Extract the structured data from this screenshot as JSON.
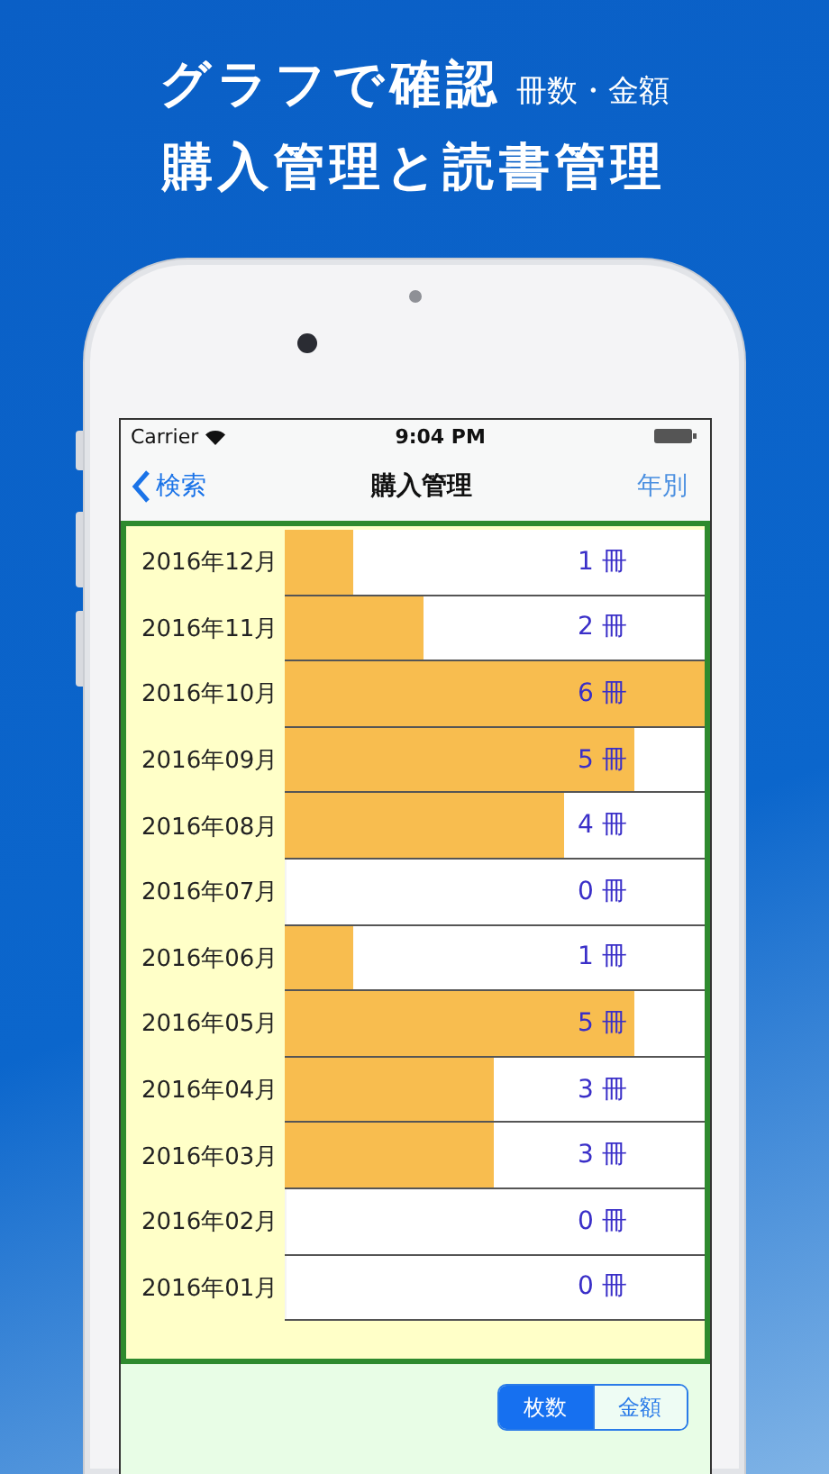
{
  "headline": {
    "title": "グラフで確認",
    "subtitle": "冊数・金額",
    "line2": "購入管理と読書管理"
  },
  "status_bar": {
    "carrier": "Carrier",
    "time": "9:04 PM"
  },
  "nav_bar": {
    "back": "検索",
    "title": "購入管理",
    "right": "年別"
  },
  "rows": [
    {
      "month": "2016年12月",
      "count": "1 冊",
      "level": 0.167
    },
    {
      "month": "2016年11月",
      "count": "2 冊",
      "level": 0.333
    },
    {
      "month": "2016年10月",
      "count": "6 冊",
      "level": 1
    },
    {
      "month": "2016年09月",
      "count": "5 冊",
      "level": 0.833
    },
    {
      "month": "2016年08月",
      "count": "4 冊",
      "level": 0.667
    },
    {
      "month": "2016年07月",
      "count": "0 冊",
      "level": 0
    },
    {
      "month": "2016年06月",
      "count": "1 冊",
      "level": 0.167
    },
    {
      "month": "2016年05月",
      "count": "5 冊",
      "level": 0.833
    },
    {
      "month": "2016年04月",
      "count": "3 冊",
      "level": 0.5
    },
    {
      "month": "2016年03月",
      "count": "3 冊",
      "level": 0.5
    },
    {
      "month": "2016年02月",
      "count": "0 冊",
      "level": 0
    },
    {
      "month": "2016年01月",
      "count": "0 冊",
      "level": 0
    }
  ],
  "segments": [
    {
      "label": "枚数",
      "selected": true
    },
    {
      "label": "金額",
      "selected": false
    }
  ]
}
